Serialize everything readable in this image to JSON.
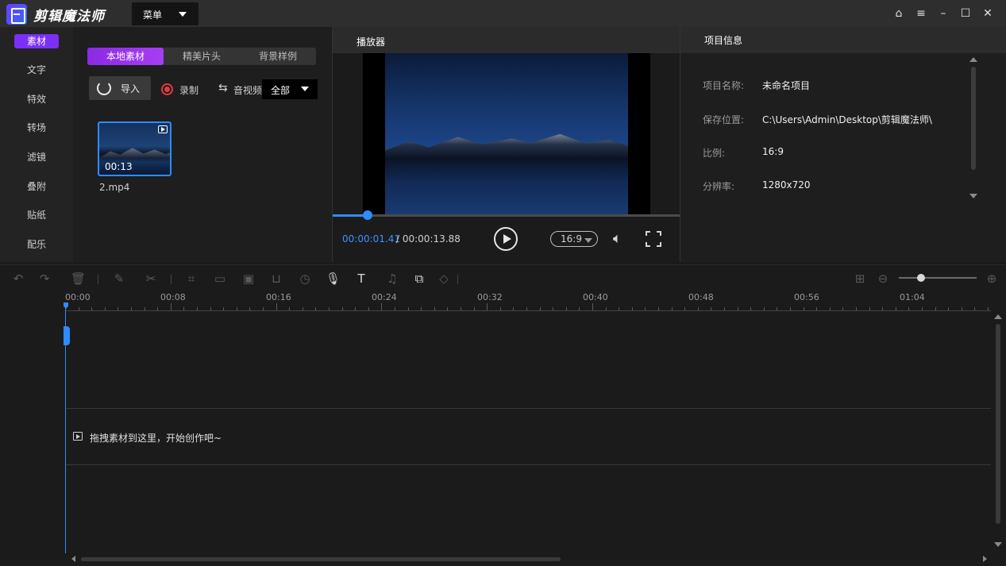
{
  "app": {
    "title": "剪辑魔法师",
    "menu_label": "菜单"
  },
  "window_controls": [
    "home-icon",
    "hamburger-menu-icon",
    "minimize-icon",
    "maximize-icon",
    "close-icon"
  ],
  "sidebar": {
    "items": [
      {
        "label": "素材",
        "active": true
      },
      {
        "label": "文字"
      },
      {
        "label": "特效"
      },
      {
        "label": "转场"
      },
      {
        "label": "滤镜"
      },
      {
        "label": "叠附"
      },
      {
        "label": "贴纸"
      },
      {
        "label": "配乐"
      }
    ]
  },
  "media": {
    "tabs": [
      {
        "label": "本地素材",
        "active": true
      },
      {
        "label": "精美片头"
      },
      {
        "label": "背景样例"
      }
    ],
    "import_label": "导入",
    "record_label": "录制",
    "av_label": "音视频",
    "filter_value": "全部",
    "items": [
      {
        "name": "2.mp4",
        "duration": "00:13"
      }
    ]
  },
  "player": {
    "title": "播放器",
    "time_current": "00:00:01.41",
    "time_total": " / 00:00:13.88",
    "progress_fraction": 0.1,
    "aspect": "16:9"
  },
  "project_info": {
    "title": "项目信息",
    "fields": [
      {
        "label": "项目名称:",
        "value": "未命名项目"
      },
      {
        "label": "保存位置:",
        "value": "C:\\Users\\Admin\\Desktop\\剪辑魔法师\\"
      },
      {
        "label": "比例:",
        "value": "16:9"
      },
      {
        "label": "分辨率:",
        "value": "1280x720"
      }
    ]
  },
  "timeline": {
    "ruler_labels": [
      "00:00",
      "00:08",
      "00:16",
      "00:24",
      "00:32",
      "00:40",
      "00:48",
      "00:56",
      "01:04"
    ],
    "drop_hint": "拖拽素材到这里，开始创作吧~",
    "zoom_fraction": 0.3
  },
  "colors": {
    "accent": "#7b2ff7",
    "blue": "#2f8bff",
    "panel": "#1e1e1e"
  }
}
